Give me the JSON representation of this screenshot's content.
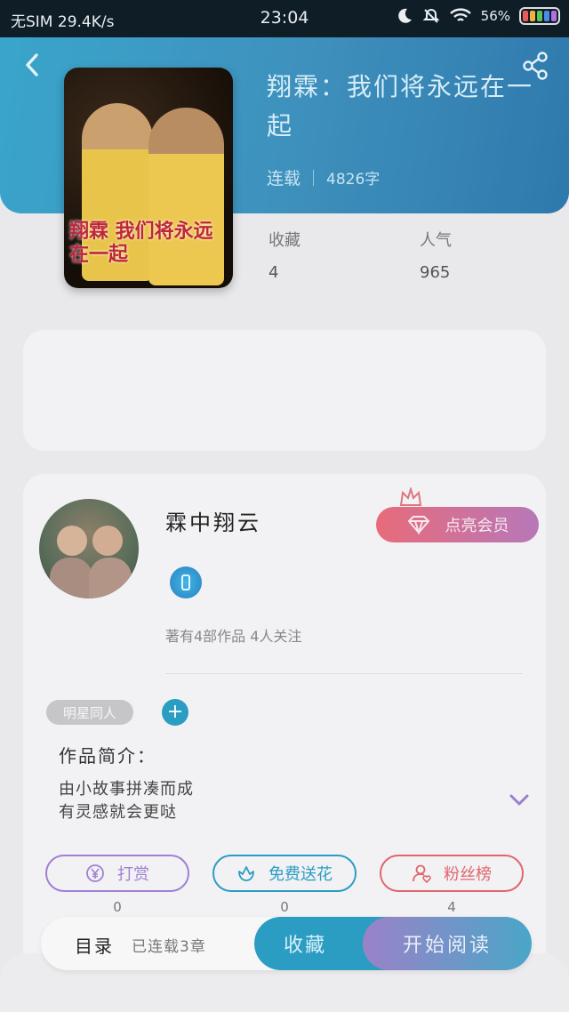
{
  "status_bar": {
    "carrier": "无SIM",
    "speed": "29.4K/s",
    "time": "23:04",
    "battery_percent": "56%",
    "battery_colors": [
      "#e85b5b",
      "#f2b13c",
      "#5bc35b",
      "#4b8be8",
      "#b16fe0"
    ]
  },
  "header": {
    "back_icon": "back-arrow-icon",
    "share_icon": "share-icon",
    "cover_title": "翔霖 我们将永远在一起"
  },
  "book": {
    "title": "翔霖：我们将永远在一起",
    "status": "连载",
    "word_count": "4826字",
    "stats": [
      {
        "label": "收藏",
        "value": "4"
      },
      {
        "label": "人气",
        "value": "965"
      }
    ]
  },
  "author": {
    "name": "霖中翔云",
    "vip_label": "点亮会员",
    "stats_text": "著有4部作品 4人关注",
    "tag": "明星同人"
  },
  "intro": {
    "label": "作品简介：",
    "line1": "由小故事拼凑而成",
    "line2": "有灵感就会更哒"
  },
  "actions": [
    {
      "label": "打赏",
      "count": "0",
      "icon": "yen-icon",
      "color": "#a07fd6"
    },
    {
      "label": "免费送花",
      "count": "0",
      "icon": "flower-icon",
      "color": "#2b9cc4"
    },
    {
      "label": "粉丝榜",
      "count": "4",
      "icon": "fans-icon",
      "color": "#e0666d"
    }
  ],
  "bottom_bar": {
    "toc_label": "目录",
    "serial_text": "已连载3章",
    "favorite_label": "收藏",
    "read_label": "开始阅读"
  },
  "colors": {
    "brand_blue": "#2c9dc2",
    "vip_gradient_start": "#e86b7a",
    "vip_gradient_end": "#b778b9"
  }
}
